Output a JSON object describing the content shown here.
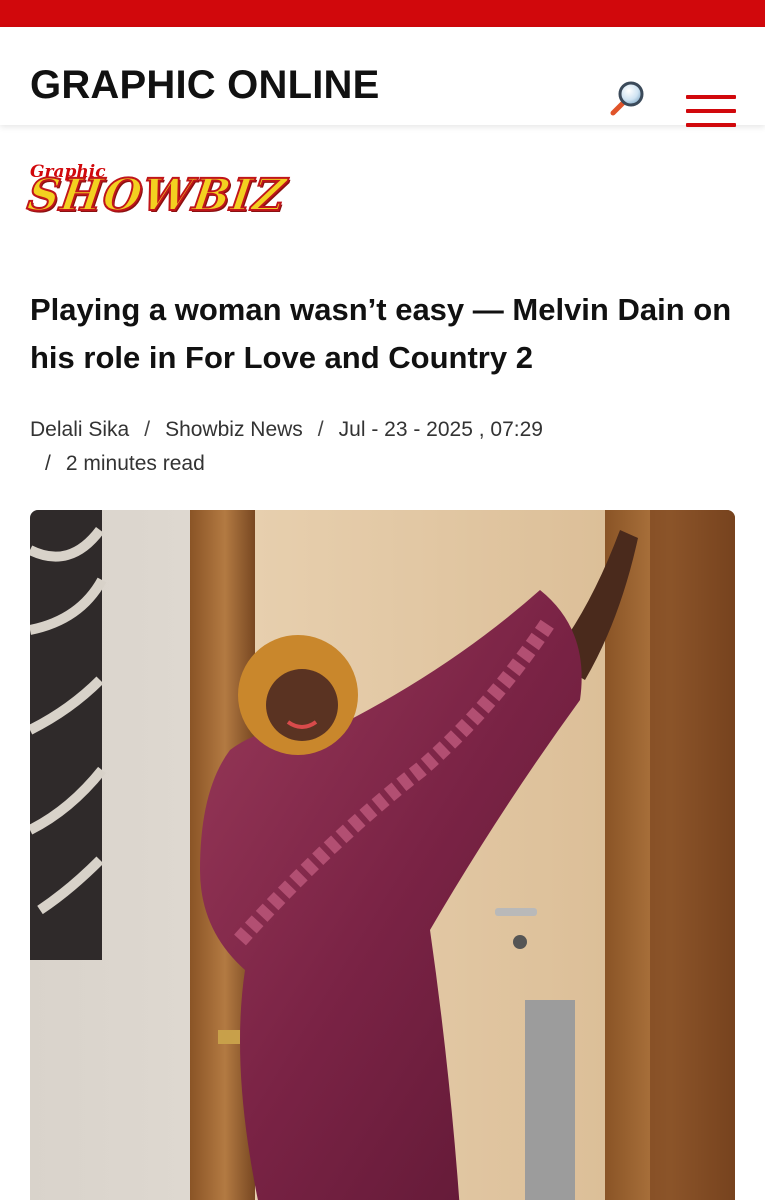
{
  "header": {
    "site_title": "GRAPHIC ONLINE",
    "search_icon": "magnifier-icon",
    "menu_icon": "hamburger-menu-icon"
  },
  "section_logo": {
    "small_text": "Graphic",
    "main_text": "SHOWBIZ"
  },
  "article": {
    "headline": "Playing a woman wasn’t easy — Melvin Dain on his role in For Love and Country 2",
    "author": "Delali Sika",
    "category": "Showbiz News",
    "date": "Jul - 23 - 2025 , 07:29",
    "read_time": "2 minutes read",
    "separator": "/"
  },
  "colors": {
    "brand_red": "#d1080c",
    "logo_yellow": "#f3d020"
  }
}
